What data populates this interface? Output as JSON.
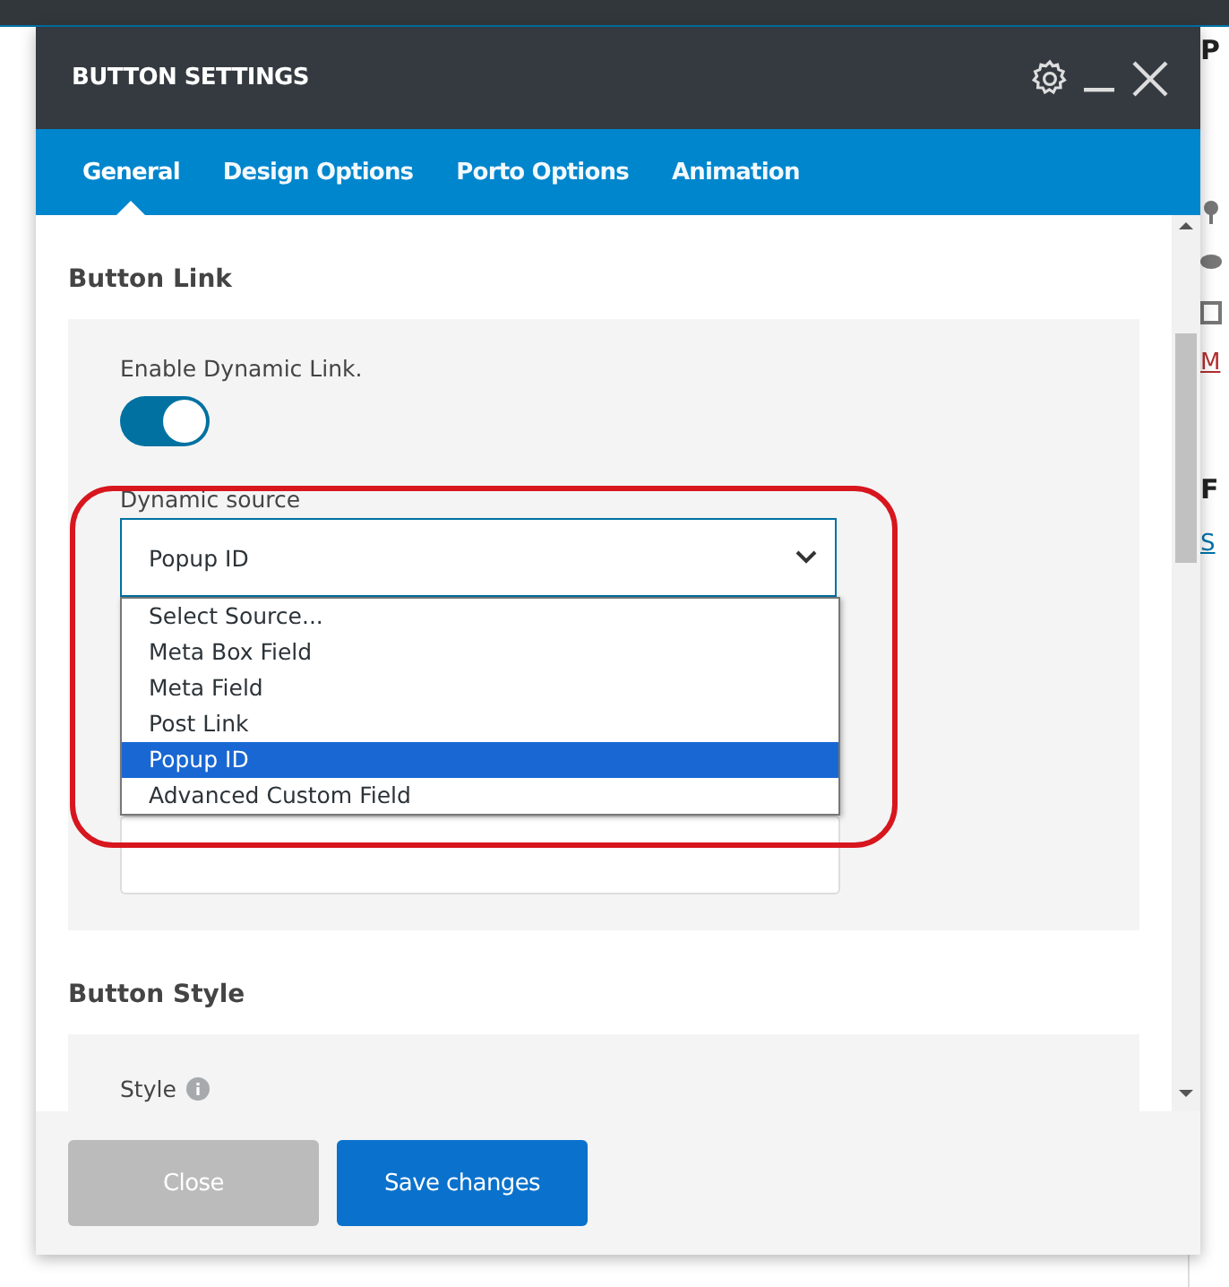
{
  "background": {
    "heading_top": "P",
    "link_red": "M",
    "heading_mid": "F",
    "link_blue": "S"
  },
  "dialog": {
    "title": "BUTTON SETTINGS",
    "tabs": [
      {
        "label": "General",
        "selected": true
      },
      {
        "label": "Design Options",
        "selected": false
      },
      {
        "label": "Porto Options",
        "selected": false
      },
      {
        "label": "Animation",
        "selected": false
      }
    ],
    "sections": [
      {
        "heading": "Button Link",
        "toggle": {
          "label": "Enable Dynamic Link.",
          "on": true
        },
        "select": {
          "label": "Dynamic source",
          "value": "Popup ID",
          "expanded": true,
          "highlighted": true,
          "options": [
            {
              "label": "Select Source...",
              "selected": false
            },
            {
              "label": "Meta Box Field",
              "selected": false
            },
            {
              "label": "Meta Field",
              "selected": false
            },
            {
              "label": "Post Link",
              "selected": false
            },
            {
              "label": "Popup ID",
              "selected": true
            },
            {
              "label": "Advanced Custom Field",
              "selected": false
            }
          ]
        }
      },
      {
        "heading": "Button Style",
        "field_label": "Style"
      }
    ],
    "buttons": [
      {
        "label": "Close",
        "kind": "secondary"
      },
      {
        "label": "Save changes",
        "kind": "primary"
      }
    ]
  }
}
